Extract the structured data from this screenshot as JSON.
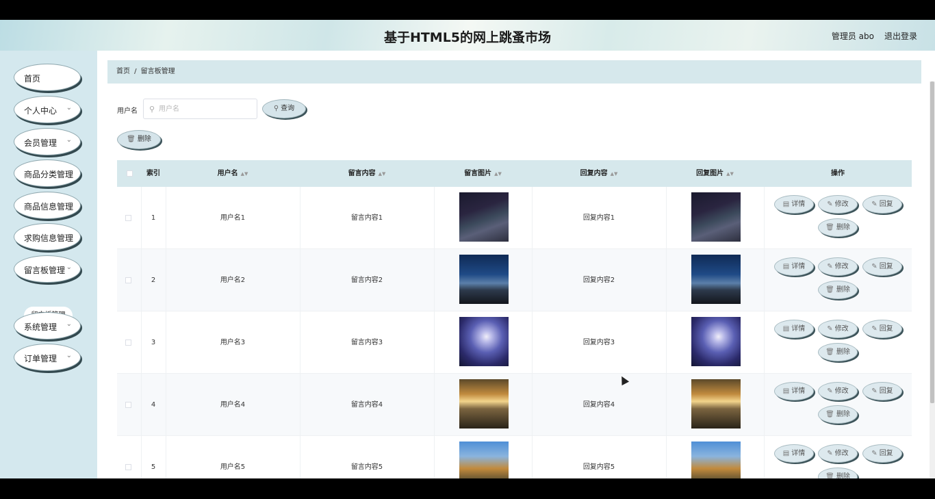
{
  "header": {
    "title": "基于HTML5的网上跳蚤市场",
    "admin": "管理员 abo",
    "logout": "退出登录"
  },
  "sidebar": {
    "items": [
      {
        "label": "首页",
        "arrow": ""
      },
      {
        "label": "个人中心",
        "arrow": "⌄"
      },
      {
        "label": "会员管理",
        "arrow": "⌄"
      },
      {
        "label": "商品分类管理",
        "arrow": ""
      },
      {
        "label": "商品信息管理",
        "arrow": ""
      },
      {
        "label": "求购信息管理",
        "arrow": ""
      },
      {
        "label": "留言板管理",
        "arrow": "⌄"
      },
      {
        "label": "系统管理",
        "arrow": "⌄"
      },
      {
        "label": "订单管理",
        "arrow": "⌄"
      }
    ],
    "subitem": "留言板管理"
  },
  "breadcrumb": {
    "home": "首页",
    "sep": "/",
    "current": "留言板管理"
  },
  "search": {
    "label": "用户名",
    "placeholder": "用户名",
    "button": "查询"
  },
  "toolbar": {
    "delete": "删除"
  },
  "table": {
    "headers": {
      "index": "索引",
      "username": "用户名",
      "content": "留言内容",
      "image": "留言图片",
      "reply": "回复内容",
      "reply_image": "回复图片",
      "actions": "操作"
    },
    "actions": {
      "detail": "详情",
      "edit": "修改",
      "reply": "回复",
      "delete": "删除"
    },
    "rows": [
      {
        "index": "1",
        "username": "用户名1",
        "content": "留言内容1",
        "reply": "回复内容1",
        "image": "night-flowers-moon"
      },
      {
        "index": "2",
        "username": "用户名2",
        "content": "留言内容2",
        "reply": "回复内容2",
        "image": "night-sky-shore"
      },
      {
        "index": "3",
        "username": "用户名3",
        "content": "留言内容3",
        "reply": "回复内容3",
        "image": "starry-nebula"
      },
      {
        "index": "4",
        "username": "用户名4",
        "content": "留言内容4",
        "reply": "回复内容4",
        "image": "sunset-sea"
      },
      {
        "index": "5",
        "username": "用户名5",
        "content": "留言内容5",
        "reply": "回复内容5",
        "image": "autumn-road"
      }
    ]
  }
}
